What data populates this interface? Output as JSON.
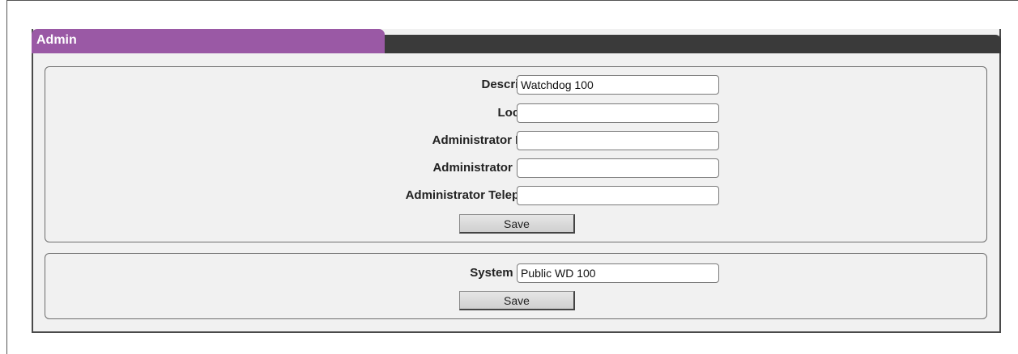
{
  "panel": {
    "title": "Admin"
  },
  "admin_form": {
    "fields": [
      {
        "label": "Description",
        "value": "Watchdog 100"
      },
      {
        "label": "Location",
        "value": ""
      },
      {
        "label": "Administrator Name",
        "value": ""
      },
      {
        "label": "Administrator Email",
        "value": ""
      },
      {
        "label": "Administrator Telephone",
        "value": ""
      }
    ],
    "save_label": "Save"
  },
  "system_form": {
    "fields": [
      {
        "label": "System Label",
        "value": "Public WD 100"
      }
    ],
    "save_label": "Save"
  },
  "colors": {
    "tab_purple": "#9a59a5",
    "header_dark": "#3a3a3a",
    "panel_bg": "#f1f1f1"
  }
}
